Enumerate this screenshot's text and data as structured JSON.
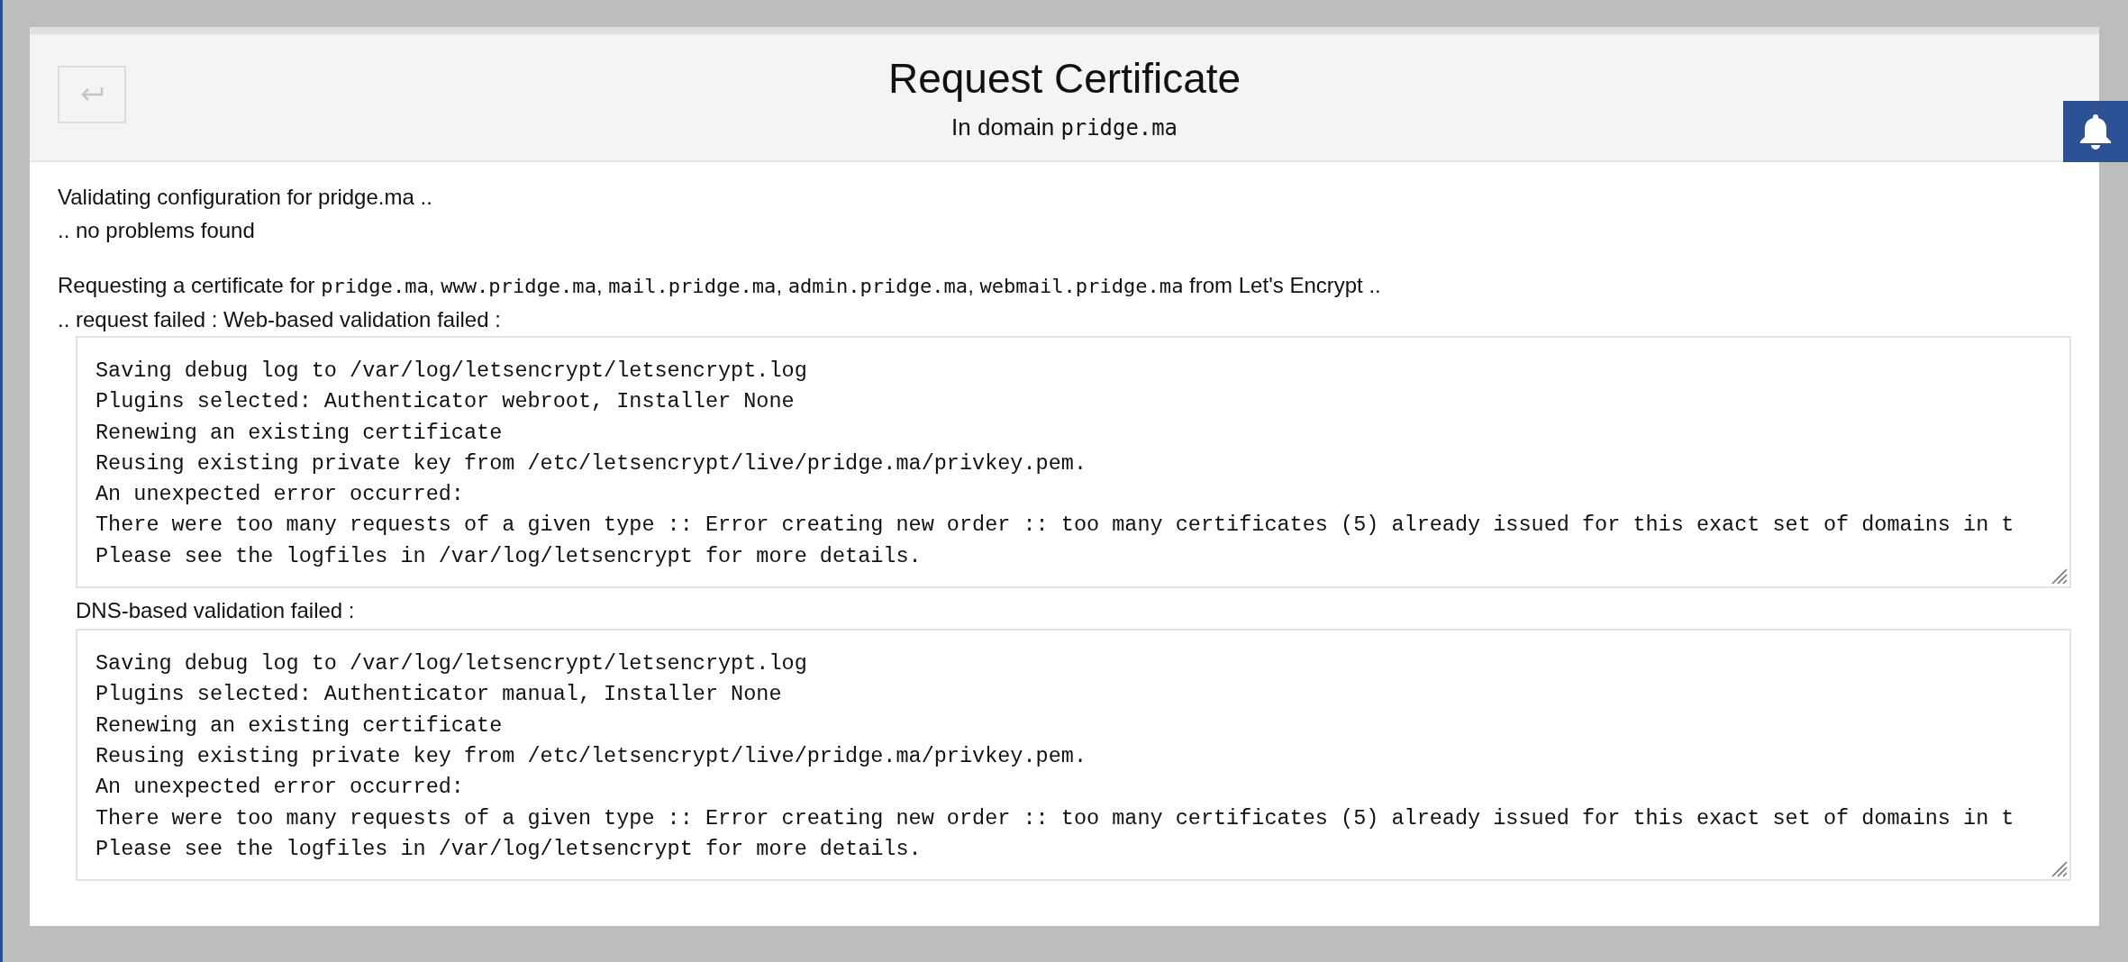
{
  "header": {
    "title": "Request Certificate",
    "subtitle": [
      {
        "kind": "text",
        "text": "In domain "
      },
      {
        "kind": "code",
        "text": "pridge.ma"
      }
    ]
  },
  "messages": [
    {
      "kind": "line",
      "parts": [
        {
          "kind": "text",
          "text": "Validating configuration for pridge.ma .."
        }
      ]
    },
    {
      "kind": "line",
      "parts": [
        {
          "kind": "text",
          "text": ".. no problems found"
        }
      ]
    },
    {
      "kind": "gap"
    },
    {
      "kind": "line",
      "parts": [
        {
          "kind": "text",
          "text": "Requesting a certificate for "
        },
        {
          "kind": "code",
          "text": "pridge.ma"
        },
        {
          "kind": "text",
          "text": ", "
        },
        {
          "kind": "code",
          "text": "www.pridge.ma"
        },
        {
          "kind": "text",
          "text": ", "
        },
        {
          "kind": "code",
          "text": "mail.pridge.ma"
        },
        {
          "kind": "text",
          "text": ", "
        },
        {
          "kind": "code",
          "text": "admin.pridge.ma"
        },
        {
          "kind": "text",
          "text": ", "
        },
        {
          "kind": "code",
          "text": "webmail.pridge.ma"
        },
        {
          "kind": "text",
          "text": " from Let's Encrypt .."
        }
      ]
    },
    {
      "kind": "line",
      "parts": [
        {
          "kind": "text",
          "text": ".. request failed : Web-based validation failed :"
        }
      ]
    }
  ],
  "logs": [
    {
      "lines": [
        "Saving debug log to /var/log/letsencrypt/letsencrypt.log",
        "Plugins selected: Authenticator webroot, Installer None",
        "Renewing an existing certificate",
        "Reusing existing private key from /etc/letsencrypt/live/pridge.ma/privkey.pem.",
        "An unexpected error occurred:",
        "There were too many requests of a given type :: Error creating new order :: too many certificates (5) already issued for this exact set of domains in t",
        "Please see the logfiles in /var/log/letsencrypt for more details."
      ]
    },
    {
      "label": "DNS-based validation failed :",
      "lines": [
        "Saving debug log to /var/log/letsencrypt/letsencrypt.log",
        "Plugins selected: Authenticator manual, Installer None",
        "Renewing an existing certificate",
        "Reusing existing private key from /etc/letsencrypt/live/pridge.ma/privkey.pem.",
        "An unexpected error occurred:",
        "There were too many requests of a given type :: Error creating new order :: too many certificates (5) already issued for this exact set of domains in t",
        "Please see the logfiles in /var/log/letsencrypt for more details."
      ]
    }
  ]
}
